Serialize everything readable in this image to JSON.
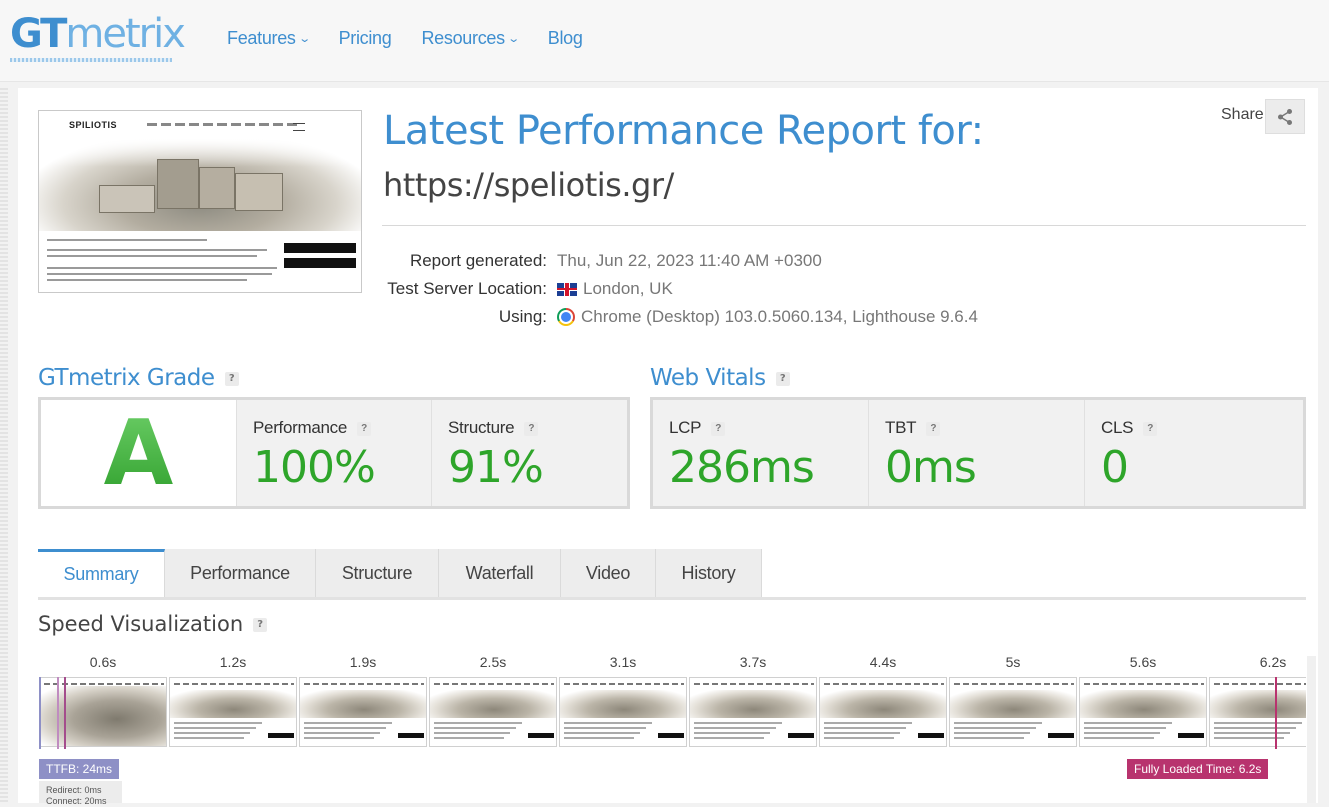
{
  "header": {
    "logo": {
      "bold": "GT",
      "light": "metrix"
    },
    "nav": [
      {
        "label": "Features",
        "has_dropdown": true
      },
      {
        "label": "Pricing",
        "has_dropdown": false
      },
      {
        "label": "Resources",
        "has_dropdown": true
      },
      {
        "label": "Blog",
        "has_dropdown": false
      }
    ]
  },
  "thumbnail": {
    "brand": "SPILIOTIS"
  },
  "report": {
    "title": "Latest Performance Report for:",
    "url": "https://speliotis.gr/",
    "share_label": "Share",
    "meta": [
      {
        "label": "Report generated:",
        "value": "Thu, Jun 22, 2023 11:40 AM +0300",
        "icon": ""
      },
      {
        "label": "Test Server Location:",
        "value": "London, UK",
        "icon": "uk-flag-icon"
      },
      {
        "label": "Using:",
        "value": "Chrome (Desktop) 103.0.5060.134, Lighthouse 9.6.4",
        "icon": "chrome-icon"
      }
    ]
  },
  "grade_section": {
    "title": "GTmetrix Grade",
    "grade": "A",
    "performance": {
      "label": "Performance",
      "value": "100%"
    },
    "structure": {
      "label": "Structure",
      "value": "91%"
    }
  },
  "vitals_section": {
    "title": "Web Vitals",
    "items": [
      {
        "label": "LCP",
        "value": "286ms"
      },
      {
        "label": "TBT",
        "value": "0ms"
      },
      {
        "label": "CLS",
        "value": "0"
      }
    ]
  },
  "tabs": [
    {
      "label": "Summary",
      "active": true
    },
    {
      "label": "Performance",
      "active": false
    },
    {
      "label": "Structure",
      "active": false
    },
    {
      "label": "Waterfall",
      "active": false
    },
    {
      "label": "Video",
      "active": false
    },
    {
      "label": "History",
      "active": false
    }
  ],
  "speed_viz": {
    "title": "Speed Visualization",
    "times": [
      "0.6s",
      "1.2s",
      "1.9s",
      "2.5s",
      "3.1s",
      "3.7s",
      "4.4s",
      "5s",
      "5.6s",
      "6.2s"
    ],
    "ttfb_label": "TTFB: 24ms",
    "ttfb_details": [
      "Redirect: 0ms",
      "Connect: 20ms"
    ],
    "fully_loaded_label": "Fully Loaded Time: 6.2s"
  },
  "colors": {
    "brand_blue": "#3e8ecf",
    "good_green": "#2ea52a",
    "ttfb": "#8e90c6",
    "fully_loaded": "#b8336e"
  }
}
